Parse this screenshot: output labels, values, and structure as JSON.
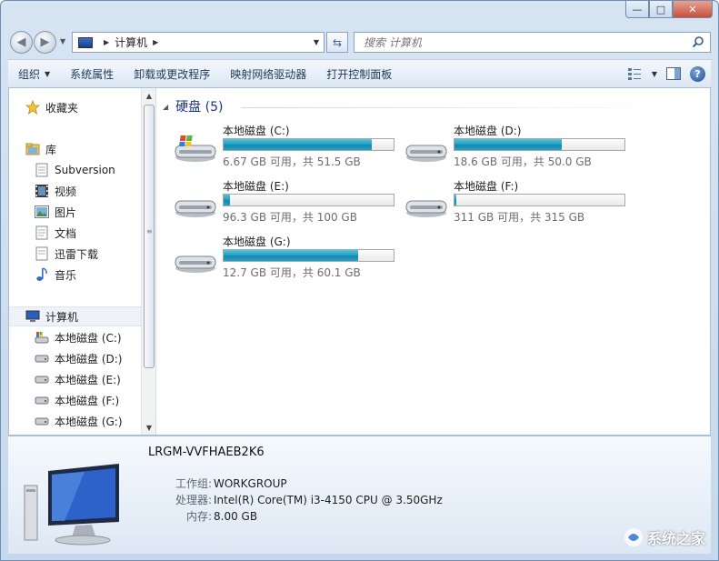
{
  "window": {
    "minimize": "—",
    "maximize": "□",
    "close": "✕"
  },
  "nav": {
    "address_root": "计算机",
    "search_placeholder": "搜索 计算机"
  },
  "toolbar": {
    "organize": "组织",
    "properties": "系统属性",
    "uninstall": "卸载或更改程序",
    "map_drive": "映射网络驱动器",
    "control_panel": "打开控制面板"
  },
  "sidebar": {
    "favorites": "收藏夹",
    "library": "库",
    "library_items": [
      "Subversion",
      "视频",
      "图片",
      "文档",
      "迅雷下载",
      "音乐"
    ],
    "computer": "计算机",
    "drives": [
      "本地磁盘 (C:)",
      "本地磁盘 (D:)",
      "本地磁盘 (E:)",
      "本地磁盘 (F:)",
      "本地磁盘 (G:)"
    ]
  },
  "content": {
    "group_title": "硬盘 (5)",
    "drives": [
      {
        "name": "本地磁盘 (C:)",
        "info": "6.67 GB 可用，共 51.5 GB",
        "used_fraction": 0.87,
        "system": true
      },
      {
        "name": "本地磁盘 (D:)",
        "info": "18.6 GB 可用，共 50.0 GB",
        "used_fraction": 0.63,
        "system": false
      },
      {
        "name": "本地磁盘 (E:)",
        "info": "96.3 GB 可用，共 100 GB",
        "used_fraction": 0.04,
        "system": false
      },
      {
        "name": "本地磁盘 (F:)",
        "info": "311 GB 可用，共 315 GB",
        "used_fraction": 0.01,
        "system": false
      },
      {
        "name": "本地磁盘 (G:)",
        "info": "12.7 GB 可用，共 60.1 GB",
        "used_fraction": 0.79,
        "system": false
      }
    ]
  },
  "details": {
    "hostname": "LRGM-VVFHAEB2K6",
    "workgroup_label": "工作组:",
    "workgroup": "WORKGROUP",
    "cpu_label": "处理器:",
    "cpu": "Intel(R) Core(TM) i3-4150 CPU @ 3.50GHz",
    "memory_label": "内存:",
    "memory": "8.00 GB"
  },
  "watermark": "系统之家",
  "colors": {
    "accent": "#1e3287",
    "bar_fill": "#26a0c4",
    "chrome": "#d7e4f2"
  }
}
